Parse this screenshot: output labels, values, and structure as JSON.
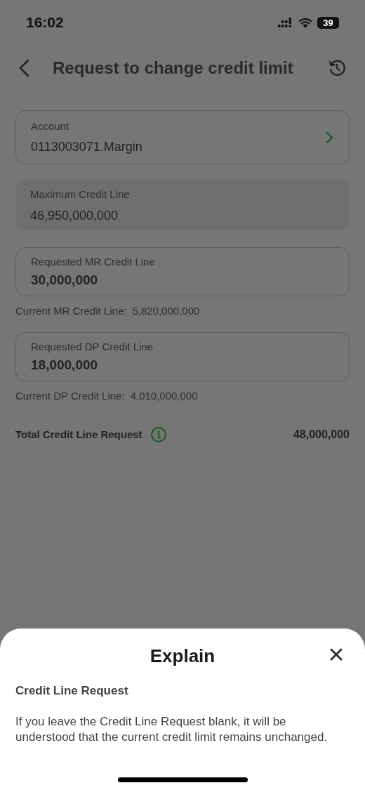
{
  "status_bar": {
    "time": "16:02",
    "battery": "39"
  },
  "header": {
    "title": "Request to change credit limit"
  },
  "fields": [
    {
      "kind": "select",
      "label": "Account",
      "value": "0113003071.Margin"
    },
    {
      "kind": "readonly",
      "label": "Maximum Credit Line",
      "value": "46,950,000,000"
    },
    {
      "kind": "input",
      "label": "Requested MR Credit Line",
      "value": "30,000,000",
      "note_label": "Current MR Credit Line:",
      "note_value": "5,820,000,000"
    },
    {
      "kind": "input",
      "label": "Requested DP Credit Line",
      "value": "18,000,000",
      "note_label": "Current DP Credit Line:",
      "note_value": "4,010,000,000"
    }
  ],
  "total": {
    "label": "Total Credit Line Request",
    "value": "48,000,000"
  },
  "sheet": {
    "title": "Explain",
    "heading": "Credit Line Request",
    "body": "If you leave the Credit Line Request blank, it will be understood that the current credit limit remains unchanged."
  }
}
